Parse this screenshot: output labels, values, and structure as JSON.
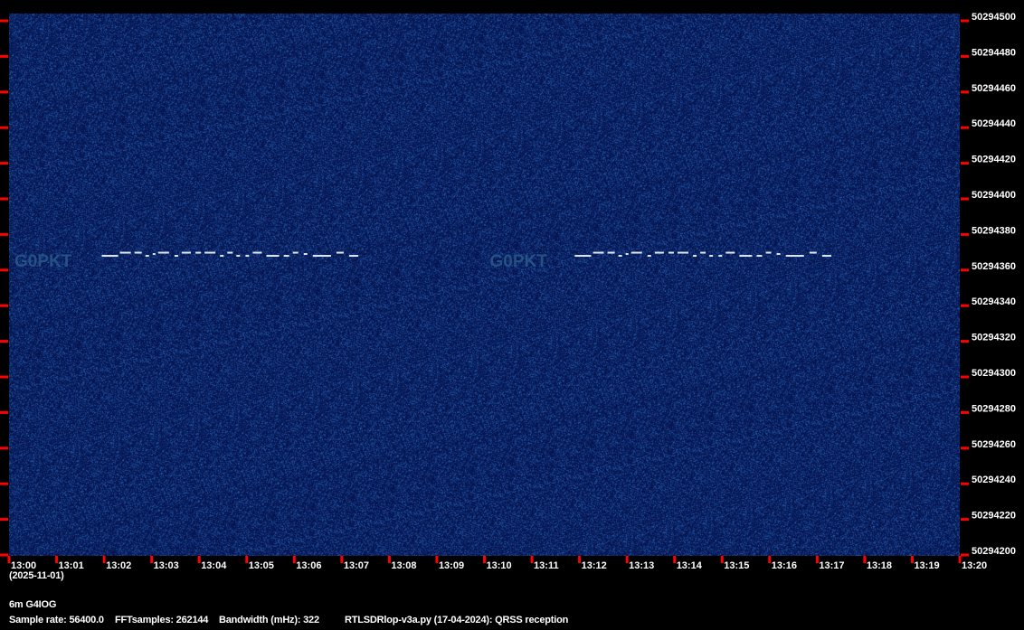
{
  "chart_data": {
    "type": "heatmap",
    "title": "QRSS spectrogram",
    "x_ticks": [
      "13:00",
      "13:01",
      "13:02",
      "13:03",
      "13:04",
      "13:05",
      "13:06",
      "13:07",
      "13:08",
      "13:09",
      "13:10",
      "13:11",
      "13:12",
      "13:13",
      "13:14",
      "13:15",
      "13:16",
      "13:17",
      "13:18",
      "13:19",
      "13:20"
    ],
    "x_range_minutes": [
      0,
      20
    ],
    "date_label": "(2025-11-01)",
    "y_ticks": [
      "50294500",
      "50294480",
      "50294460",
      "50294440",
      "50294420",
      "50294400",
      "50294380",
      "50294360",
      "50294340",
      "50294320",
      "50294300",
      "50294280",
      "50294260",
      "50294240",
      "50294220",
      "50294200"
    ],
    "ylim_hz": [
      50294200,
      50294500
    ],
    "signals": [
      {
        "label": "G0PKT",
        "start_min": 0.0,
        "text_end_min": 1.95,
        "end_min": 7.5,
        "freq_hz": 50294368
      },
      {
        "label": "G0PKT",
        "start_min": 10.0,
        "text_end_min": 11.9,
        "end_min": 17.45,
        "freq_hz": 50294368
      }
    ],
    "colors": {
      "background": "#0a1d5c",
      "signal": "#dfe8f2",
      "tick": "#ff0000"
    }
  },
  "footer": {
    "station": "6m G4IOG",
    "sample_rate": "Sample rate: 56400.0",
    "fft_samples": "FFTsamples: 262144",
    "bandwidth": "Bandwidth (mHz): 322",
    "software": "RTLSDRlop-v3a.py (17-04-2024): QRSS reception"
  }
}
